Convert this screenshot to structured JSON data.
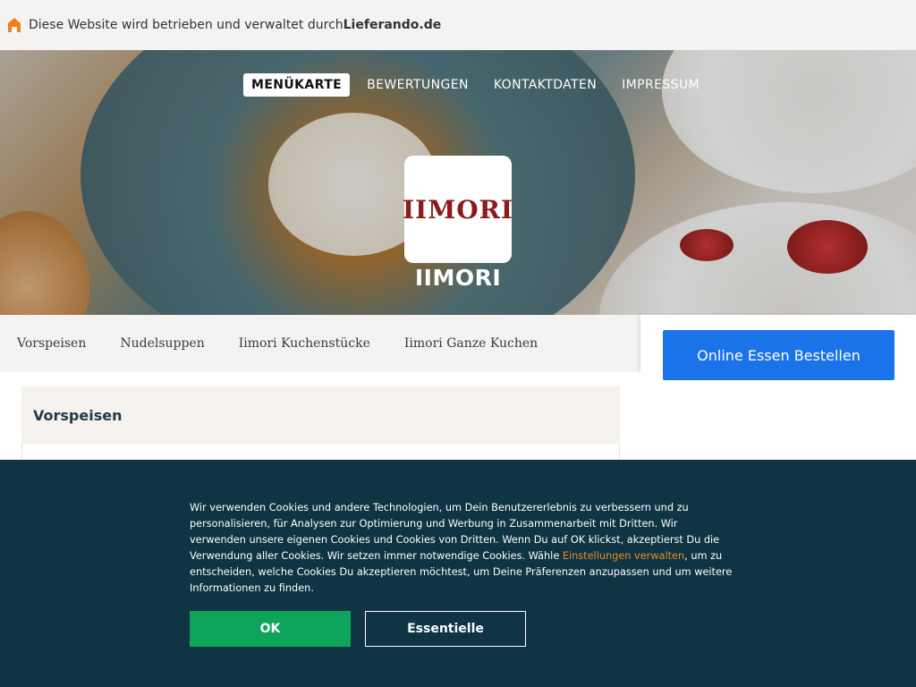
{
  "notice": {
    "text_prefix": "Diese Website wird betrieben und verwaltet durch ",
    "brand": "Lieferando.de",
    "icon": "home-icon",
    "icon_color": "#f07e1b"
  },
  "nav": {
    "items": [
      {
        "label": "MENÜKARTE",
        "active": true
      },
      {
        "label": "BEWERTUNGEN",
        "active": false
      },
      {
        "label": "KONTAKTDATEN",
        "active": false
      },
      {
        "label": "IMPRESSUM",
        "active": false
      }
    ]
  },
  "restaurant": {
    "logo_text": "IIMORI",
    "name": "IIMORI",
    "logo_color": "#8b1a1a"
  },
  "categories": [
    {
      "label": "Vorspeisen"
    },
    {
      "label": "Nudelsuppen"
    },
    {
      "label": "Iimori Kuchenstücke"
    },
    {
      "label": "Iimori Ganze Kuchen"
    }
  ],
  "order": {
    "button_label": "Online Essen Bestellen",
    "color": "#1a73e8"
  },
  "section": {
    "title": "Vorspeisen"
  },
  "cookie": {
    "text_before_link": "Wir verwenden Cookies und andere Technologien, um Dein Benutzererlebnis zu verbessern und zu personalisieren, für Analysen zur Optimierung und Werbung in Zusammenarbeit mit Dritten. Wir verwenden unsere eigenen Cookies und Cookies von Dritten. Wenn Du auf OK klickst, akzeptierst Du die Verwendung aller Cookies. Wir setzen immer notwendige Cookies. Wähle ",
    "link": "Einstellungen verwalten",
    "text_after_link": ", um zu entscheiden, welche Cookies Du akzeptieren möchtest, um Deine Präferenzen anzupassen und um weitere Informationen zu finden.",
    "ok_label": "OK",
    "essential_label": "Essentielle",
    "background": "#0f3443",
    "ok_color": "#0ea55a",
    "link_color": "#f08a24"
  }
}
